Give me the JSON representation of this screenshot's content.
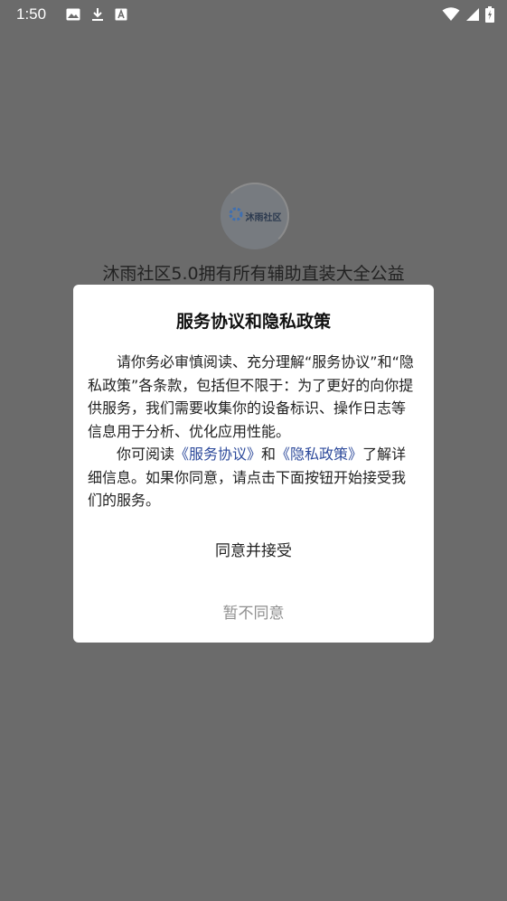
{
  "status_bar": {
    "time": "1:50",
    "icons_left": [
      "image-icon",
      "download-icon",
      "font-icon"
    ],
    "icons_right": [
      "wifi-icon",
      "signal-icon",
      "battery-charging-icon"
    ]
  },
  "splash": {
    "logo_text": "沐雨社区",
    "title": "沐雨社区5.0拥有所有辅助直装大全公益"
  },
  "dialog": {
    "title": "服务协议和隐私政策",
    "para1": "请你务必审慎阅读、充分理解“服务协议”和“隐私政策”各条款，包括但不限于：为了更好的向你提供服务，我们需要收集你的设备标识、操作日志等信息用于分析、优化应用性能。",
    "para2_prefix": "你可阅读",
    "service_link": "《服务协议》",
    "para2_and": "和",
    "privacy_link": "《隐私政策》",
    "para2_suffix": "了解详细信息。如果你同意，请点击下面按钮开始接受我们的服务。",
    "agree_label": "同意并接受",
    "disagree_label": "暂不同意"
  },
  "colors": {
    "overlay": "#6b6b6b",
    "link": "#2d4a9b",
    "dialog_bg": "#ffffff"
  }
}
